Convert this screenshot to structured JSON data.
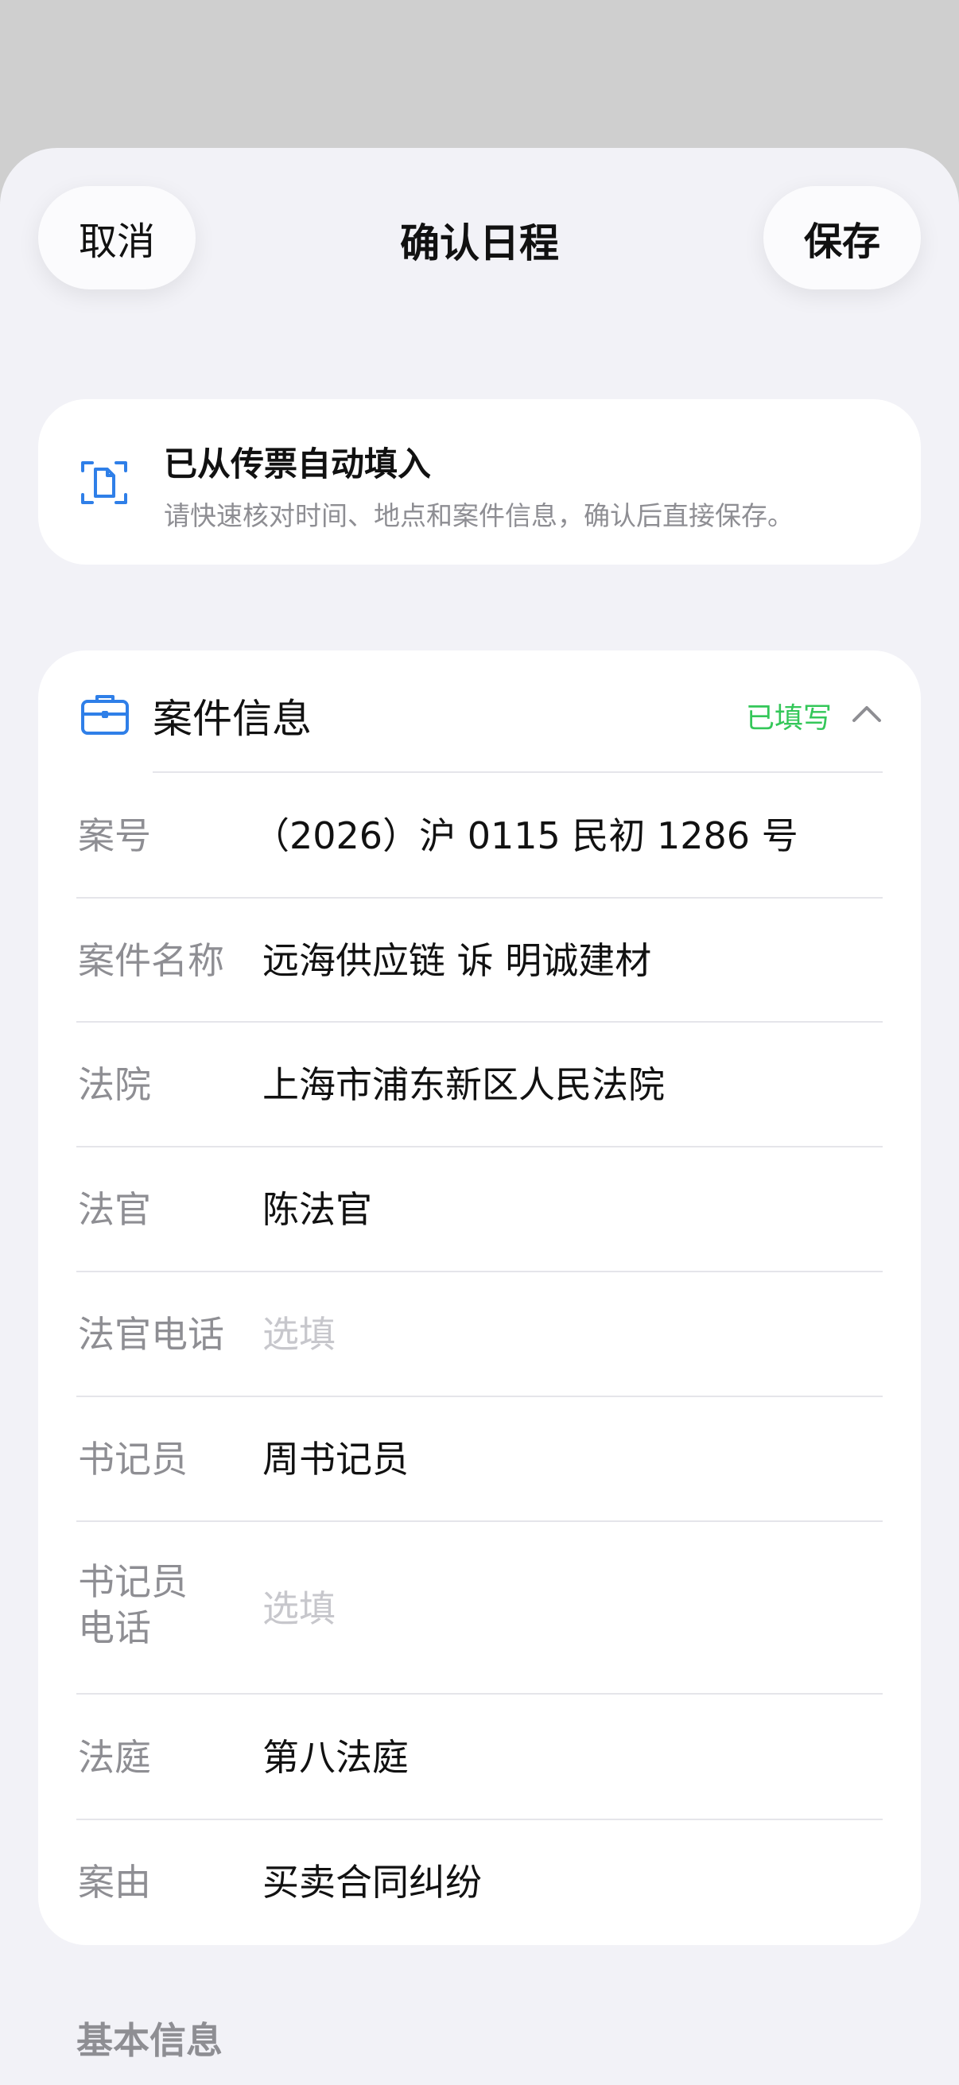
{
  "header": {
    "cancel_label": "取消",
    "title": "确认日程",
    "save_label": "保存"
  },
  "banner": {
    "icon": "document-scan-icon",
    "title": "已从传票自动填入",
    "subtitle": "请快速核对时间、地点和案件信息，确认后直接保存。"
  },
  "case_section": {
    "icon": "briefcase-icon",
    "title": "案件信息",
    "status": "已填写",
    "chevron": "chevron-up-icon",
    "fields": [
      {
        "label": "案号",
        "value": "（2026）沪 0115 民初 1286 号"
      },
      {
        "label": "案件名称",
        "value": "远海供应链 诉 明诚建材"
      },
      {
        "label": "法院",
        "value": "上海市浦东新区人民法院"
      },
      {
        "label": "法官",
        "value": "陈法官"
      },
      {
        "label": "法官电话",
        "value": "",
        "placeholder": "选填"
      },
      {
        "label": "书记员",
        "value": "周书记员"
      },
      {
        "label_lines": [
          "书记员",
          "电话"
        ],
        "value": "",
        "placeholder": "选填"
      },
      {
        "label": "法庭",
        "value": "第八法庭"
      },
      {
        "label": "案由",
        "value": "买卖合同纠纷"
      }
    ]
  },
  "basic_section": {
    "title": "基本信息"
  },
  "colors": {
    "accent_blue": "#2f7fe8",
    "status_green": "#34c759",
    "background": "#f2f2f7",
    "label_gray": "#8e8e93"
  }
}
